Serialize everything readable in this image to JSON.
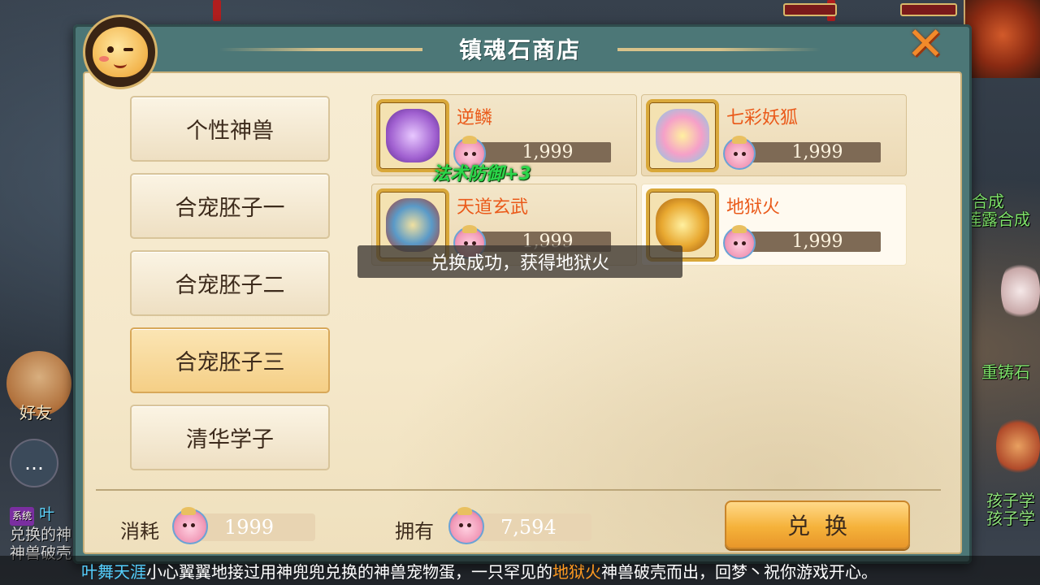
{
  "shop": {
    "title": "镇魂石商店",
    "close_icon": "close-x-icon"
  },
  "categories": [
    {
      "label": "个性神兽",
      "active": false
    },
    {
      "label": "合宠胚子一",
      "active": false
    },
    {
      "label": "合宠胚子二",
      "active": false
    },
    {
      "label": "合宠胚子三",
      "active": true
    },
    {
      "label": "清华学子",
      "active": false
    }
  ],
  "items": [
    {
      "name": "逆鳞",
      "price": "1,999",
      "icon": "purple-dragon-pet-icon",
      "color": "#b27ad8"
    },
    {
      "name": "七彩妖狐",
      "price": "1,999",
      "icon": "rainbow-fox-pet-icon",
      "color": "#f5a0c8"
    },
    {
      "name": "天道玄武",
      "price": "1,999",
      "icon": "tortoise-warrior-pet-icon",
      "color": "#5a9ac8"
    },
    {
      "name": "地狱火",
      "price": "1,999",
      "icon": "golden-hellfire-pet-icon",
      "color": "#e8a830"
    }
  ],
  "buff_popup": "法术防御+3",
  "toast": "兑换成功，获得地狱火",
  "footer": {
    "cost_label": "消耗",
    "cost_value": "1999",
    "own_label": "拥有",
    "own_value": "7,594",
    "exchange_label": "兑换"
  },
  "ticker": {
    "player": "叶舞天涯",
    "text1": "小心翼翼地接过用神兜兜兑换的神兽宠物蛋，一只罕见的",
    "pet": "地狱火",
    "text2": "神兽破壳而出，回梦丶祝你游戏开心。"
  },
  "background": {
    "friend_label": "好友",
    "side_labels": [
      "合成",
      "莲露合成",
      "重铸石",
      "孩子学",
      "孩子学"
    ],
    "chat_tag": "系统",
    "chat_name": "叶",
    "chat_lines": [
      "兑换的神",
      "神兽破壳"
    ]
  }
}
